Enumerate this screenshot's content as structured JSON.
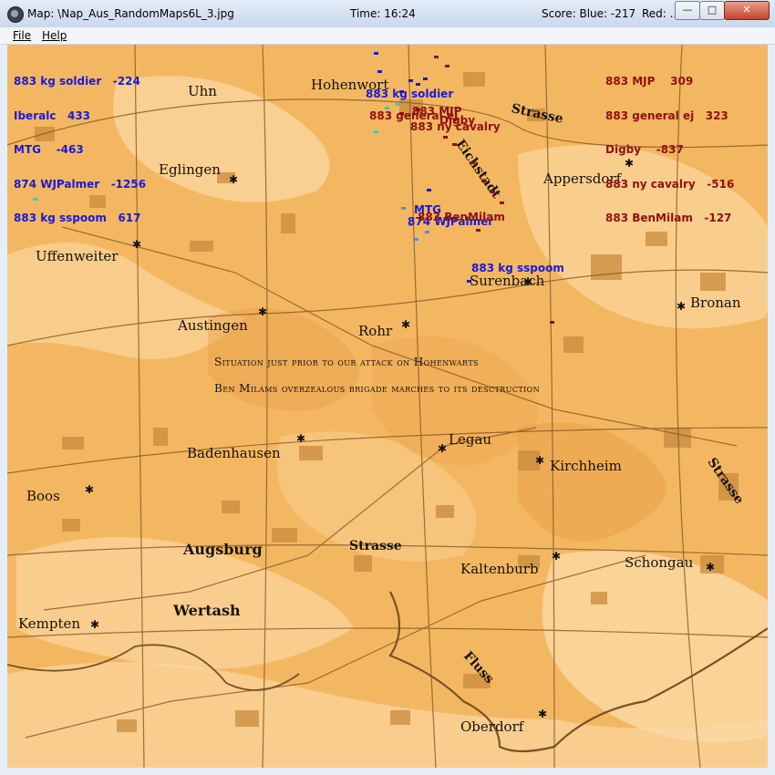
{
  "window": {
    "title": "Map: \\Nap_Aus_RandomMaps6L_3.jpg",
    "time": "Time: 16:24",
    "score_blue": "Score: Blue: -217",
    "score_red": "Red: ..."
  },
  "menu": {
    "file": "File",
    "help": "Help"
  },
  "legend": {
    "blue": [
      "883 kg soldier   -224",
      "Iberalc   433",
      "MTG    -463",
      "874 WJPalmer   -1256",
      "883 kg sspoom   617"
    ],
    "red": [
      "883 MJP    309",
      "883 general ej   323",
      "Digby    -837",
      "883 ny cavalry   -516",
      "883 BenMilam   -127"
    ]
  },
  "captions": [
    "Situation just prior to our attack on Hohenwarts",
    "Ben Milams overzealous brigade marches to its desctruction"
  ],
  "towns": [
    "Hohenwort",
    "Uhn",
    "Eglingen",
    "Appersdorf",
    "Uffenweiter",
    "Surenbach",
    "Bronan",
    "Austingen",
    "Rohr",
    "Legau",
    "Badenhausen",
    "Kirchheim",
    "Boos",
    "Augsburg",
    "Kaltenburb",
    "Schongau",
    "Wertash",
    "Kempten",
    "Oberdorf"
  ],
  "roads": [
    "Strasse",
    "Eichstadt",
    "Strasse",
    "Strasse",
    "Fluss"
  ],
  "units": {
    "blue_soldier": "883 kg soldier",
    "mjp": "883 MJP",
    "general": "883 general ej",
    "digby": "Digby",
    "cavalry": "883 ny cavalry",
    "mtg": "MTG",
    "wjpalmer": "874 WJPalmer",
    "benmilam": "883 BenMilam",
    "sspoom": "883 kg sspoom"
  },
  "colors": {
    "blue": "#1a1ad6",
    "red": "#8e1010",
    "map_base": "#f4b761"
  }
}
